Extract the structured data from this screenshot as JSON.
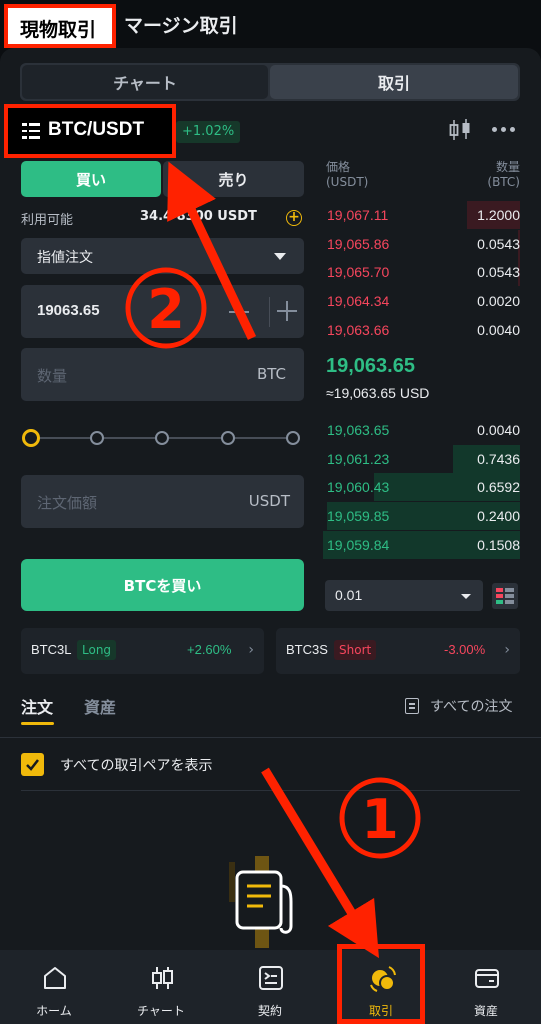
{
  "top_tabs": {
    "spot": "現物取引",
    "margin": "マージン取引"
  },
  "view_switch": {
    "chart": "チャート",
    "trade": "取引"
  },
  "pair": {
    "symbol": "BTC/USDT",
    "change": "+1.02%"
  },
  "order_form": {
    "buy_tab": "買い",
    "sell_tab": "売り",
    "available_label": "利用可能",
    "available_value": "34.4   8300 USDT",
    "order_type": "指値注文",
    "price_value": "19063.65",
    "quantity_placeholder": "数量",
    "quantity_unit": "BTC",
    "slider_steps": 5,
    "slider_level": 0,
    "total_placeholder": "注文価額",
    "total_unit": "USDT",
    "buy_button": "BTCを買い"
  },
  "order_book": {
    "price_header": [
      "価格",
      "(USDT)"
    ],
    "qty_header": [
      "数量",
      "(BTC)"
    ],
    "asks": [
      {
        "price": "19,067.11",
        "qty": "1.2000",
        "depth": 0.27
      },
      {
        "price": "19,065.86",
        "qty": "0.0543",
        "depth": 0.01
      },
      {
        "price": "19,065.70",
        "qty": "0.0543",
        "depth": 0.01
      },
      {
        "price": "19,064.34",
        "qty": "0.0020",
        "depth": 0.0
      },
      {
        "price": "19,063.66",
        "qty": "0.0040",
        "depth": 0.0
      }
    ],
    "mid_price": "19,063.65",
    "mid_fiat": "≈19,063.65 USD",
    "bids": [
      {
        "price": "19,063.65",
        "qty": "0.0040",
        "depth": 0.0
      },
      {
        "price": "19,061.23",
        "qty": "0.7436",
        "depth": 0.34
      },
      {
        "price": "19,060.43",
        "qty": "0.6592",
        "depth": 0.74
      },
      {
        "price": "19,059.85",
        "qty": "0.2400",
        "depth": 0.98
      },
      {
        "price": "19,059.84",
        "qty": "0.1508",
        "depth": 1.0
      }
    ],
    "precision": "0.01"
  },
  "leveraged_tokens": [
    {
      "name": "BTC3L",
      "tag": "Long",
      "change": "+2.60%",
      "tag_color": "#2ebd85"
    },
    {
      "name": "BTC3S",
      "tag": "Short",
      "change": "-3.00%",
      "tag_color": "#f6465d"
    }
  ],
  "orders": {
    "tab_orders": "注文",
    "tab_assets": "資産",
    "all_orders": "すべての注文",
    "show_all_pairs": "すべての取引ペアを表示",
    "show_all_checked": true
  },
  "bottom_nav": [
    {
      "label": "ホーム",
      "icon": "home-icon"
    },
    {
      "label": "チャート",
      "icon": "candlestick-icon"
    },
    {
      "label": "契約",
      "icon": "futures-icon"
    },
    {
      "label": "取引",
      "icon": "trade-icon"
    },
    {
      "label": "資産",
      "icon": "wallet-icon"
    }
  ],
  "annotations": {
    "circle_1": "①",
    "circle_2": "②"
  },
  "colors": {
    "buy_green": "#2ebd85",
    "sell_red": "#f6465d",
    "accent_yellow": "#f0b90b",
    "annotation_red": "#ff2200"
  }
}
